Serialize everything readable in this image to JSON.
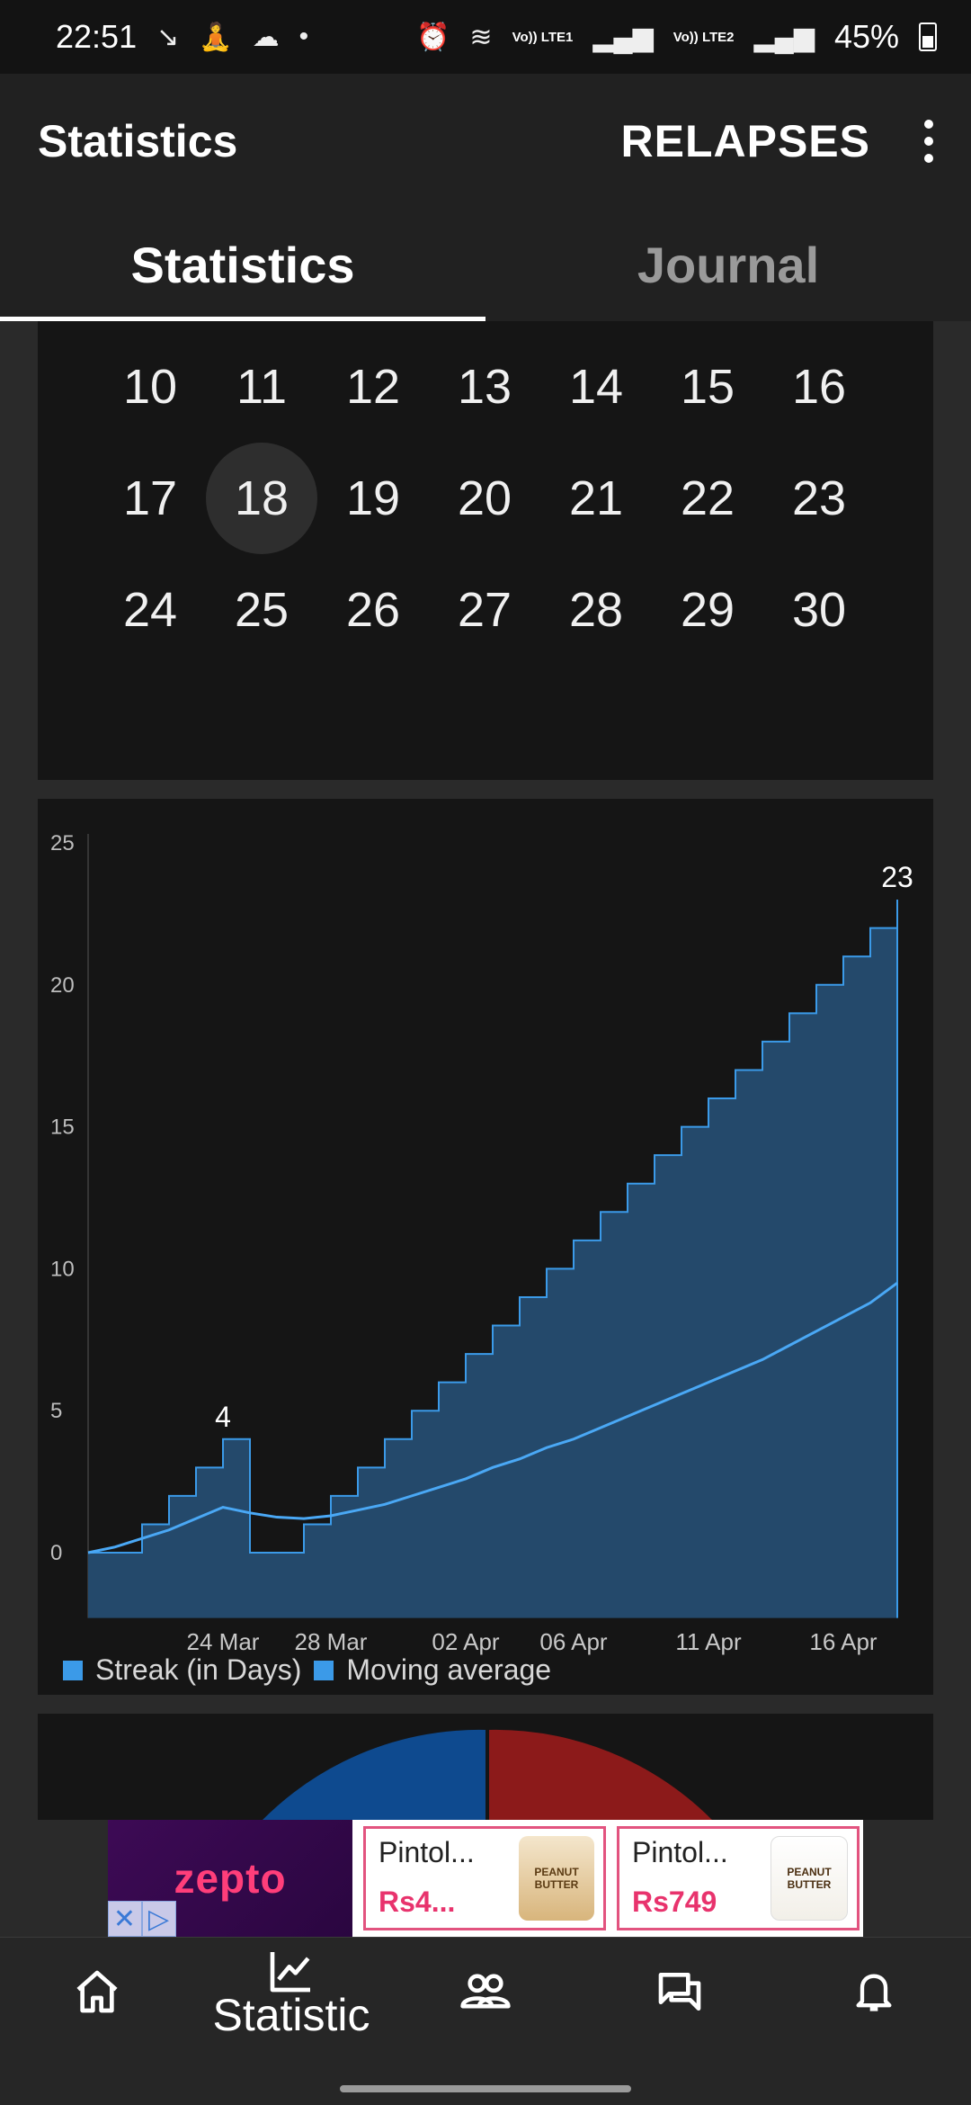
{
  "status_bar": {
    "time": "22:51",
    "network1": "Vo)) LTE1",
    "network2": "Vo)) LTE2",
    "battery": "45%"
  },
  "app_bar": {
    "title": "Statistics",
    "action_label": "RELAPSES"
  },
  "tabs": [
    {
      "label": "Statistics",
      "active": true
    },
    {
      "label": "Journal",
      "active": false
    }
  ],
  "calendar": {
    "weeks": [
      [
        "10",
        "11",
        "12",
        "13",
        "14",
        "15",
        "16"
      ],
      [
        "17",
        "18",
        "19",
        "20",
        "21",
        "22",
        "23"
      ],
      [
        "24",
        "25",
        "26",
        "27",
        "28",
        "29",
        "30"
      ]
    ],
    "selected_day": "18"
  },
  "chart_data": {
    "type": "area",
    "y_ticks": [
      "25",
      "20",
      "15",
      "10",
      "5",
      "0"
    ],
    "ylim": [
      -2.3,
      25
    ],
    "x_tick_labels": [
      "24 Mar",
      "28 Mar",
      "02 Apr",
      "06 Apr",
      "11 Apr",
      "16 Apr"
    ],
    "x_tick_dates": [
      "2024-03-24",
      "2024-03-28",
      "2024-04-02",
      "2024-04-06",
      "2024-04-11",
      "2024-04-16"
    ],
    "xlim": [
      "2024-03-19",
      "2024-04-18"
    ],
    "grid": false,
    "legend_position": "bottom",
    "series": [
      {
        "name": "Streak (in Days)",
        "color": "#3b9ae8",
        "fill": "#24496b",
        "points": [
          [
            "2024-03-19",
            0
          ],
          [
            "2024-03-20",
            0
          ],
          [
            "2024-03-21",
            1
          ],
          [
            "2024-03-22",
            2
          ],
          [
            "2024-03-23",
            3
          ],
          [
            "2024-03-24",
            4
          ],
          [
            "2024-03-25",
            0
          ],
          [
            "2024-03-26",
            0
          ],
          [
            "2024-03-27",
            1
          ],
          [
            "2024-03-28",
            2
          ],
          [
            "2024-03-29",
            3
          ],
          [
            "2024-03-30",
            4
          ],
          [
            "2024-03-31",
            5
          ],
          [
            "2024-04-01",
            6
          ],
          [
            "2024-04-02",
            7
          ],
          [
            "2024-04-03",
            8
          ],
          [
            "2024-04-04",
            9
          ],
          [
            "2024-04-05",
            10
          ],
          [
            "2024-04-06",
            11
          ],
          [
            "2024-04-07",
            12
          ],
          [
            "2024-04-08",
            13
          ],
          [
            "2024-04-09",
            14
          ],
          [
            "2024-04-10",
            15
          ],
          [
            "2024-04-11",
            16
          ],
          [
            "2024-04-12",
            17
          ],
          [
            "2024-04-13",
            18
          ],
          [
            "2024-04-14",
            19
          ],
          [
            "2024-04-15",
            20
          ],
          [
            "2024-04-16",
            21
          ],
          [
            "2024-04-17",
            22
          ],
          [
            "2024-04-18",
            23
          ]
        ]
      },
      {
        "name": "Moving average",
        "color": "#4aa8f5",
        "points": [
          [
            "2024-03-19",
            0
          ],
          [
            "2024-03-20",
            0.2
          ],
          [
            "2024-03-21",
            0.5
          ],
          [
            "2024-03-22",
            0.8
          ],
          [
            "2024-03-23",
            1.2
          ],
          [
            "2024-03-24",
            1.6
          ],
          [
            "2024-03-25",
            1.4
          ],
          [
            "2024-03-26",
            1.25
          ],
          [
            "2024-03-27",
            1.2
          ],
          [
            "2024-03-28",
            1.3
          ],
          [
            "2024-03-29",
            1.5
          ],
          [
            "2024-03-30",
            1.7
          ],
          [
            "2024-03-31",
            2.0
          ],
          [
            "2024-04-01",
            2.3
          ],
          [
            "2024-04-02",
            2.6
          ],
          [
            "2024-04-03",
            3.0
          ],
          [
            "2024-04-04",
            3.3
          ],
          [
            "2024-04-05",
            3.7
          ],
          [
            "2024-04-06",
            4.0
          ],
          [
            "2024-04-07",
            4.4
          ],
          [
            "2024-04-08",
            4.8
          ],
          [
            "2024-04-09",
            5.2
          ],
          [
            "2024-04-10",
            5.6
          ],
          [
            "2024-04-11",
            6.0
          ],
          [
            "2024-04-12",
            6.4
          ],
          [
            "2024-04-13",
            6.8
          ],
          [
            "2024-04-14",
            7.3
          ],
          [
            "2024-04-15",
            7.8
          ],
          [
            "2024-04-16",
            8.3
          ],
          [
            "2024-04-17",
            8.8
          ],
          [
            "2024-04-18",
            9.5
          ]
        ]
      }
    ],
    "annotations": [
      {
        "date": "2024-03-24",
        "value": 4,
        "text": "4"
      },
      {
        "date": "2024-04-18",
        "value": 23,
        "text": "23"
      }
    ]
  },
  "ad": {
    "brand": "zepto",
    "products": [
      {
        "name": "Pintol...",
        "price": "Rs4...",
        "img_label": "PEANUT BUTTER"
      },
      {
        "name": "Pintol...",
        "price": "Rs749",
        "img_label": "PEANUT BUTTER"
      }
    ]
  },
  "bottom_nav": {
    "items": [
      {
        "icon": "home-icon"
      },
      {
        "icon": "chart-icon",
        "label": "Statistic"
      },
      {
        "icon": "people-icon"
      },
      {
        "icon": "chat-icon"
      },
      {
        "icon": "bell-icon"
      }
    ]
  }
}
